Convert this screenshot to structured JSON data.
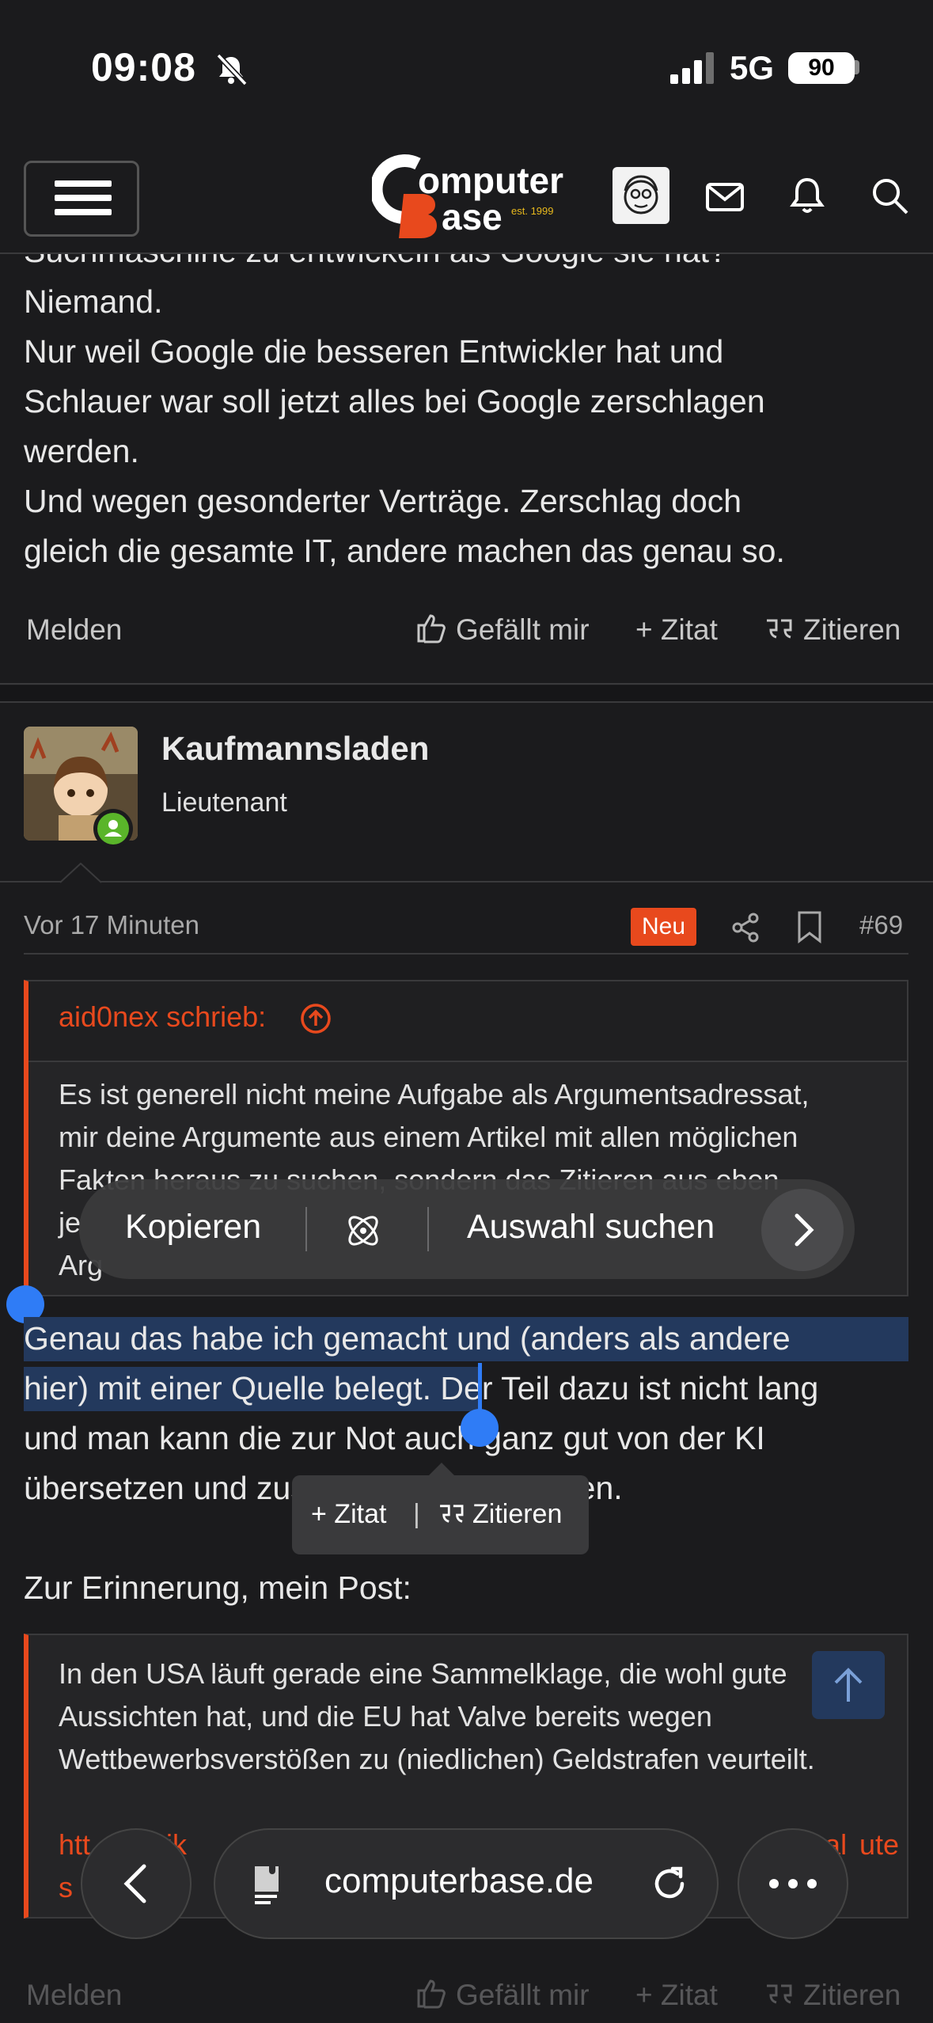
{
  "status_bar": {
    "time": "09:08",
    "network": "5G",
    "battery": "90"
  },
  "header": {
    "logo_line1": "omputer",
    "logo_line2": "ase",
    "logo_est": "est. 1999"
  },
  "prev_post": {
    "cut_line": "Suchmaschine zu entwickeln als Google sie hat?",
    "lines": [
      "Niemand.",
      "Nur weil Google die besseren Entwickler hat und",
      "Schlauer war soll jetzt alles bei Google zerschlagen",
      "werden.",
      "Und wegen gesonderter Verträge. Zerschlag doch",
      "gleich die gesamte IT, andere machen das genau so."
    ],
    "actions": {
      "report": "Melden",
      "like": "Gefällt mir",
      "add_quote": "+ Zitat",
      "quote": "Zitieren"
    }
  },
  "post": {
    "username": "Kaufmannsladen",
    "rank": "Lieutenant",
    "date": "Vor 17 Minuten",
    "badge": "Neu",
    "number": "#69",
    "quote1": {
      "author": "aid0nex schrieb:",
      "lines": [
        "Es ist generell nicht meine Aufgabe als Argumentsadressat,",
        "mir deine Argumente aus einem Artikel mit allen möglichen",
        "Fakten heraus zu suchen, sondern das Zitieren aus eben",
        "je",
        "Arg"
      ]
    },
    "reply_selected_1": "Genau das habe ich gemacht und (anders als andere",
    "reply_selected_2": "hier) mit einer Quelle belegt.",
    "reply_rest_2": " Der Teil dazu ist nicht lang",
    "reply_line_3": "und man kann die zur Not auch ganz gut von der KI",
    "reply_line_4": "übersetzen und zusammenfassen lassen.",
    "reminder": "Zur Erinnerung, mein Post:",
    "quote2": {
      "lines": [
        "In den USA läuft gerade eine Sammelklage, die wohl gute",
        "Aussichten hat, und die EU hat Valve bereits wegen",
        "Wettbewerbsverstößen zu (niedlichen) Geldstrafen veurteilt."
      ],
      "link_part1": "htt",
      "link_part2": "n.wik",
      "link_part3": "egal",
      "link_part4": "ute",
      "link_part5": "s"
    },
    "actions": {
      "report": "Melden",
      "like": "Gefällt mir",
      "add_quote": "+ Zitat",
      "quote": "Zitieren"
    }
  },
  "context_menu": {
    "copy": "Kopieren",
    "search": "Auswahl suchen"
  },
  "quote_popup": {
    "add_quote": "+ Zitat",
    "divider": "|",
    "quote": "Zitieren"
  },
  "browser": {
    "url": "computerbase.de"
  },
  "colors": {
    "accent": "#e8491d",
    "selection": "#23395d",
    "handle": "#2f7cf6"
  }
}
